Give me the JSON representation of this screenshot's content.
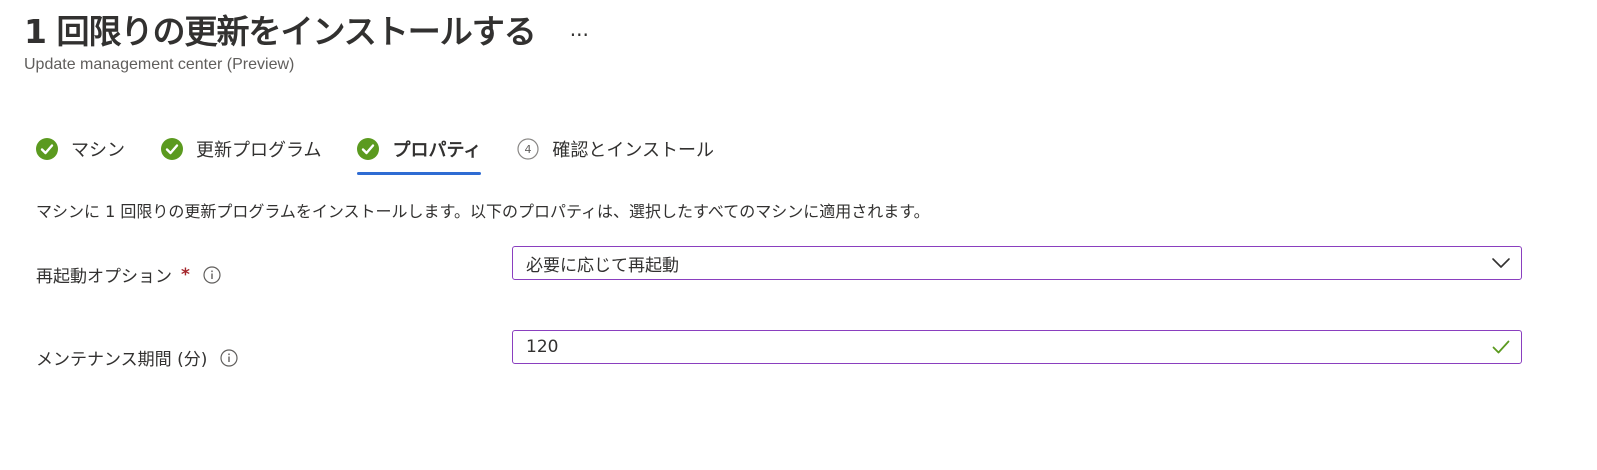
{
  "header": {
    "title": "1 回限りの更新をインストールする",
    "more_label": "...",
    "subtitle": "Update management center (Preview)"
  },
  "tabs": [
    {
      "label": "マシン",
      "icon": "check-circle-icon",
      "state": "completed"
    },
    {
      "label": "更新プログラム",
      "icon": "check-circle-icon",
      "state": "completed"
    },
    {
      "label": "プロパティ",
      "icon": "check-circle-icon",
      "state": "active"
    },
    {
      "label": "確認とインストール",
      "icon": "step-number-icon",
      "step": "4",
      "state": "pending"
    }
  ],
  "description": "マシンに 1 回限りの更新プログラムをインストールします。以下のプロパティは、選択したすべてのマシンに適用されます。",
  "fields": {
    "reboot": {
      "label": "再起動オプション",
      "required_mark": "*",
      "value": "必要に応じて再起動"
    },
    "maintenance": {
      "label": "メンテナンス期間 (分)",
      "value": "120"
    }
  },
  "colors": {
    "success": "#5b9a1f",
    "accent": "#2f6cd3",
    "field_border": "#8a3fbf",
    "required": "#a4262c"
  }
}
